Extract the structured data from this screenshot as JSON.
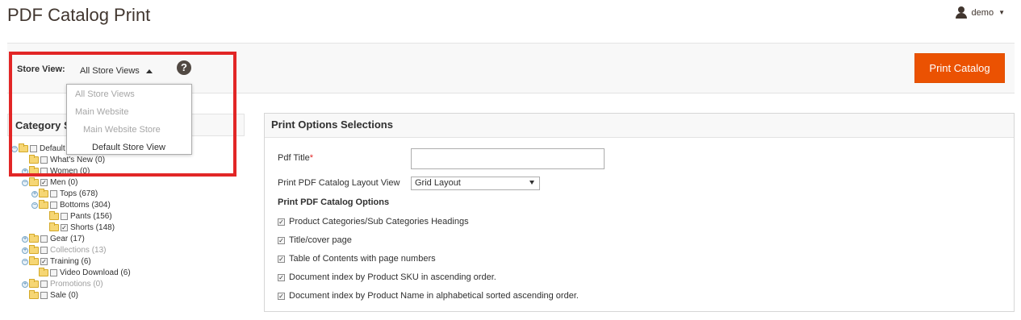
{
  "header": {
    "title": "PDF Catalog Print",
    "user_name": "demo"
  },
  "toolbar": {
    "store_view_label": "Store View:",
    "store_view_selected": "All Store Views",
    "help_symbol": "?",
    "print_button": "Print Catalog"
  },
  "store_dropdown": {
    "options": [
      "All Store Views",
      "Main Website",
      "Main Website Store",
      "Default Store View"
    ]
  },
  "category_panel": {
    "title": "Category S",
    "items": [
      {
        "label": "Default",
        "checked": false
      },
      {
        "label": "What's New (0)",
        "checked": false
      },
      {
        "label": "Women (0)",
        "checked": false
      },
      {
        "label": "Men (0)",
        "checked": true
      },
      {
        "label": "Tops (678)",
        "checked": false
      },
      {
        "label": "Bottoms (304)",
        "checked": false
      },
      {
        "label": "Pants (156)",
        "checked": false
      },
      {
        "label": "Shorts (148)",
        "checked": true
      },
      {
        "label": "Gear (17)",
        "checked": false
      },
      {
        "label": "Collections (13)",
        "checked": false
      },
      {
        "label": "Training (6)",
        "checked": true
      },
      {
        "label": "Video Download (6)",
        "checked": false
      },
      {
        "label": "Promotions (0)",
        "checked": false
      },
      {
        "label": "Sale (0)",
        "checked": false
      }
    ]
  },
  "print_options": {
    "title": "Print Options Selections",
    "pdf_title_label": "Pdf Title",
    "required_mark": "*",
    "pdf_title_value": "",
    "layout_label": "Print PDF Catalog Layout View",
    "layout_value": "Grid Layout",
    "options_heading": "Print PDF Catalog Options",
    "options": [
      {
        "label": "Product Categories/Sub Categories Headings",
        "checked": true
      },
      {
        "label": "Title/cover page",
        "checked": true
      },
      {
        "label": "Table of Contents with page numbers",
        "checked": true
      },
      {
        "label": "Document index by Product SKU in ascending order.",
        "checked": true
      },
      {
        "label": "Document index by Product Name in alphabetical sorted ascending order.",
        "checked": true
      }
    ]
  },
  "colors": {
    "accent": "#eb5202",
    "highlight_box": "#e22626"
  }
}
